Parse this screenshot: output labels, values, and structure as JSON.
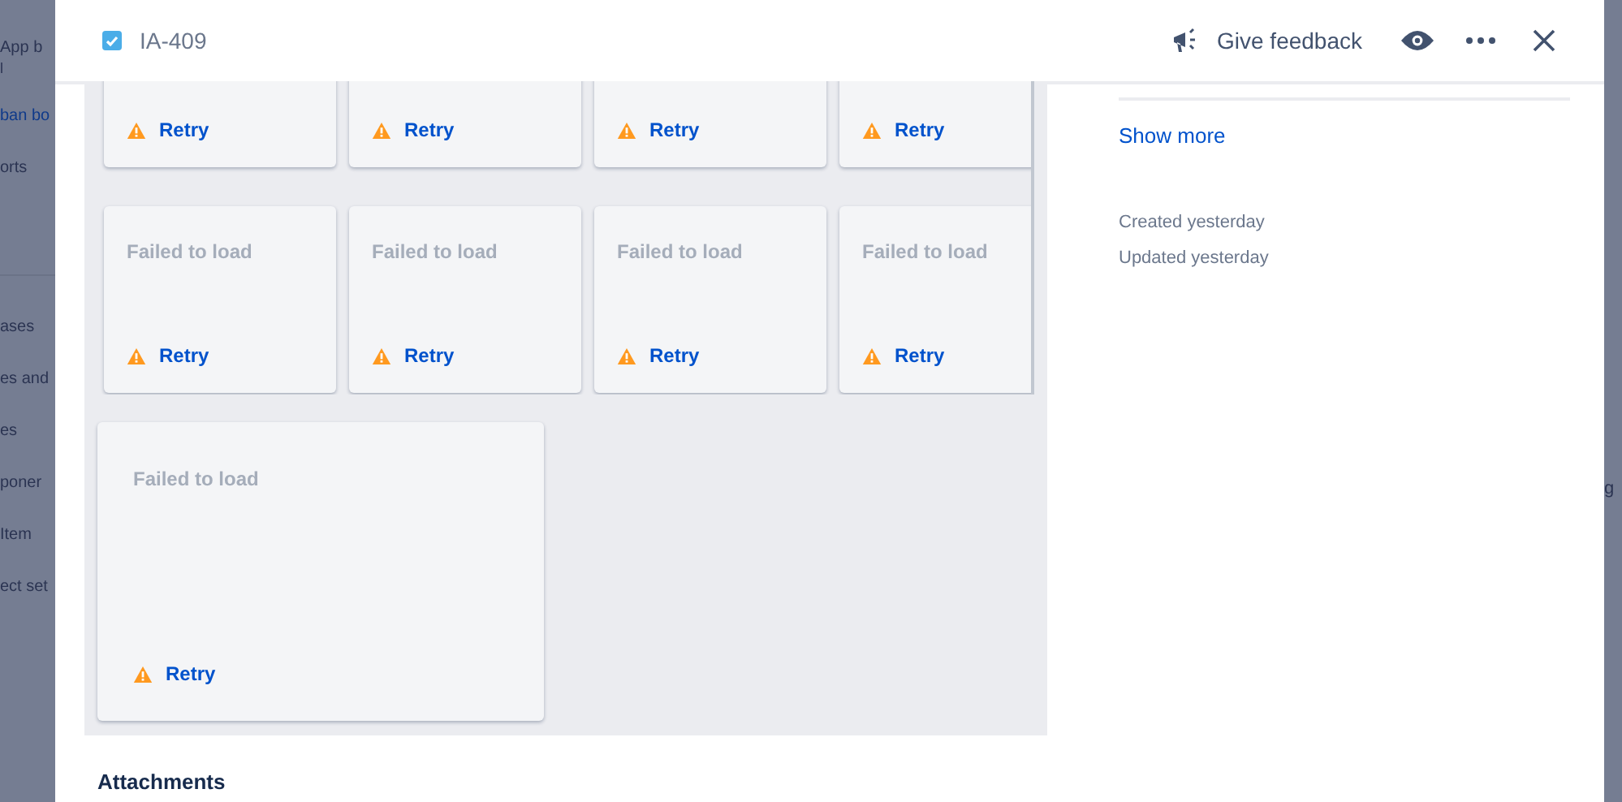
{
  "background": {
    "sidebar_items": [
      {
        "label": "App b",
        "sublabel": "l",
        "selected": false
      },
      {
        "label": "ban bo",
        "selected": true
      },
      {
        "label": "orts",
        "selected": false
      },
      {
        "label": "ases",
        "selected": false
      },
      {
        "label": "es and",
        "selected": false
      },
      {
        "label": "es",
        "selected": false
      },
      {
        "label": "poner",
        "selected": false
      },
      {
        "label": "Item",
        "selected": false
      },
      {
        "label": "ect set",
        "selected": false
      }
    ],
    "right_text": "g"
  },
  "header": {
    "issue_key": "IA-409",
    "checked": true,
    "feedback": "Give feedback"
  },
  "cards": [
    [
      {
        "retry": "Retry"
      },
      {
        "retry": "Retry"
      },
      {
        "retry": "Retry"
      },
      {
        "retry": "Retry"
      }
    ],
    [
      {
        "message": "Failed to load",
        "retry": "Retry"
      },
      {
        "message": "Failed to load",
        "retry": "Retry"
      },
      {
        "message": "Failed to load",
        "retry": "Retry"
      },
      {
        "message": "Failed to load",
        "retry": "Retry"
      }
    ]
  ],
  "large_card": {
    "message": "Failed to load",
    "retry": "Retry"
  },
  "attachments_heading": "Attachments",
  "details": {
    "show_more": "Show more",
    "created": "Created yesterday",
    "updated": "Updated yesterday"
  }
}
